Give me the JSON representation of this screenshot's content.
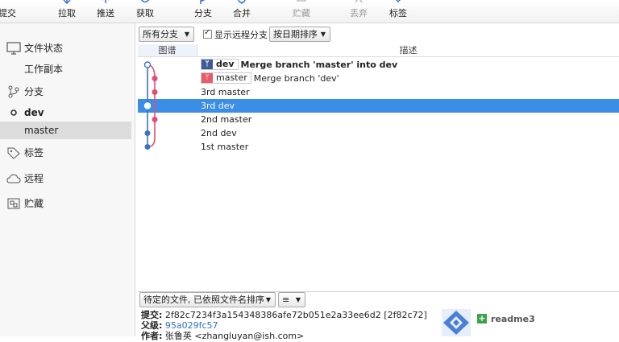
{
  "toolbar": {
    "commit": "提交",
    "pull": "拉取",
    "push": "推送",
    "fetch": "获取",
    "branch": "分支",
    "merge": "合并",
    "stash": "贮藏",
    "discard": "丢弃",
    "tag": "标签"
  },
  "sidebar": {
    "file_status": "文件状态",
    "working_copy": "工作副本",
    "branches": "分支",
    "branch_dev": "dev",
    "branch_master": "master",
    "tags": "标签",
    "remotes": "远程",
    "stashes": "贮藏"
  },
  "filters": {
    "branches_dropdown": "所有分支",
    "show_remote_label": "显示远程分支",
    "show_remote_checked": true,
    "sort_dropdown": "按日期排序"
  },
  "history": {
    "columns": {
      "graph": "图谱",
      "description": "描述"
    },
    "rows": [
      {
        "tag": "dev",
        "tag_color": "#3c5a98",
        "desc": "Merge branch 'master' into dev",
        "bold": true,
        "selected": false
      },
      {
        "tag": "master",
        "tag_color": "#e35d6a",
        "desc": "Merge branch 'dev'",
        "bold": false,
        "selected": false
      },
      {
        "tag": "",
        "desc": "3rd master",
        "bold": false,
        "selected": false
      },
      {
        "tag": "",
        "desc": "3rd dev",
        "bold": false,
        "selected": true
      },
      {
        "tag": "",
        "desc": "2nd master",
        "bold": false,
        "selected": false
      },
      {
        "tag": "",
        "desc": "2nd dev",
        "bold": false,
        "selected": false
      },
      {
        "tag": "",
        "desc": "1st master",
        "bold": false,
        "selected": false
      }
    ],
    "colors": {
      "blue_line": "#3d72c9",
      "pink_line": "#e34d6f",
      "selection": "#3a8ee6"
    }
  },
  "bottom": {
    "pending_dropdown": "待定的文件, 已依照文件名排序",
    "view_dropdown": "≡"
  },
  "details": {
    "commit_label": "提交:",
    "commit_value": "2f82c7234f3a154348386afe72b051e2a33ee6d2 [2f82c72]",
    "parent_label": "父级:",
    "parent_value": "95a029fc57",
    "author_label": "作者:",
    "author_value": "张鲁英 <zhangluyan@ish.com>",
    "file_name": "readme3"
  }
}
